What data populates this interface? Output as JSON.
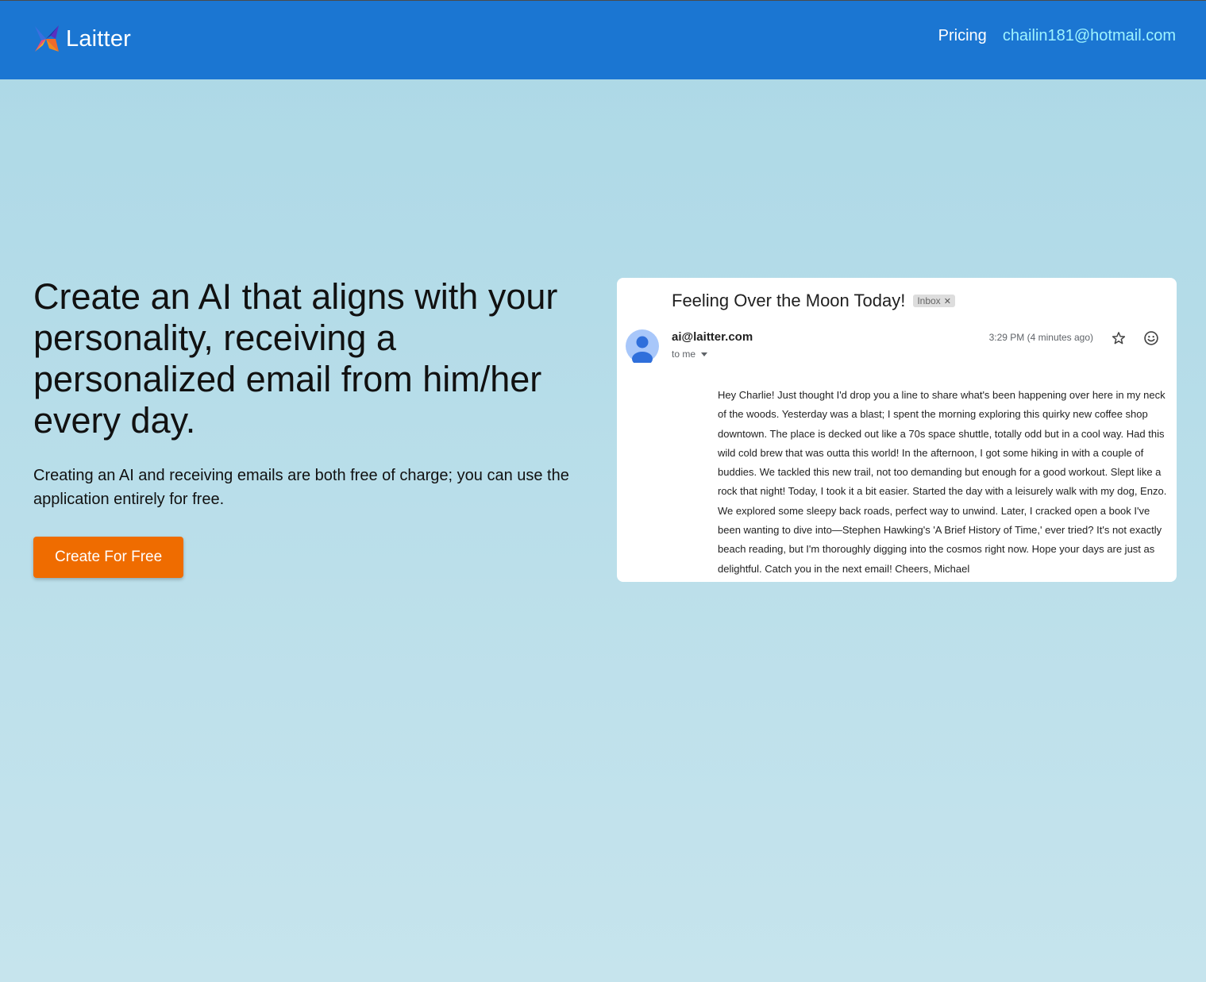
{
  "header": {
    "brand": "Laitter",
    "nav_pricing": "Pricing",
    "nav_email": "chailin181@hotmail.com"
  },
  "hero": {
    "headline": "Create an AI that aligns with your personality, receiving a personalized email from him/her every day.",
    "subline": "Creating an AI and receiving emails are both free of charge; you can use the application entirely for free.",
    "cta_label": "Create For Free"
  },
  "email_preview": {
    "subject": "Feeling Over the Moon Today!",
    "tag": "Inbox",
    "sender": "ai@laitter.com",
    "recipient": "to me",
    "time": "3:29 PM (4 minutes ago)",
    "body": "Hey Charlie! Just thought I'd drop you a line to share what's been happening over here in my neck of the woods. Yesterday was a blast; I spent the morning exploring this quirky new coffee shop downtown. The place is decked out like a 70s space shuttle, totally odd but in a cool way. Had this wild cold brew that was outta this world! In the afternoon, I got some hiking in with a couple of buddies. We tackled this new trail, not too demanding but enough for a good workout. Slept like a rock that night! Today, I took it a bit easier. Started the day with a leisurely walk with my dog, Enzo. We explored some sleepy back roads, perfect way to unwind. Later, I cracked open a book I've been wanting to dive into—Stephen Hawking's 'A Brief History of Time,' ever tried? It's not exactly beach reading, but I'm thoroughly digging into the cosmos right now. Hope your days are just as delightful. Catch you in the next email! Cheers, Michael",
    "icons": [
      "person-avatar-icon",
      "star-icon",
      "emoji-icon"
    ]
  },
  "colors": {
    "header_bg": "#1b76d2",
    "email_link": "#9ef4ff",
    "cta_bg": "#ef6c00",
    "page_bg_top": "#acd8e6",
    "page_bg_bottom": "#c6e4ed"
  }
}
